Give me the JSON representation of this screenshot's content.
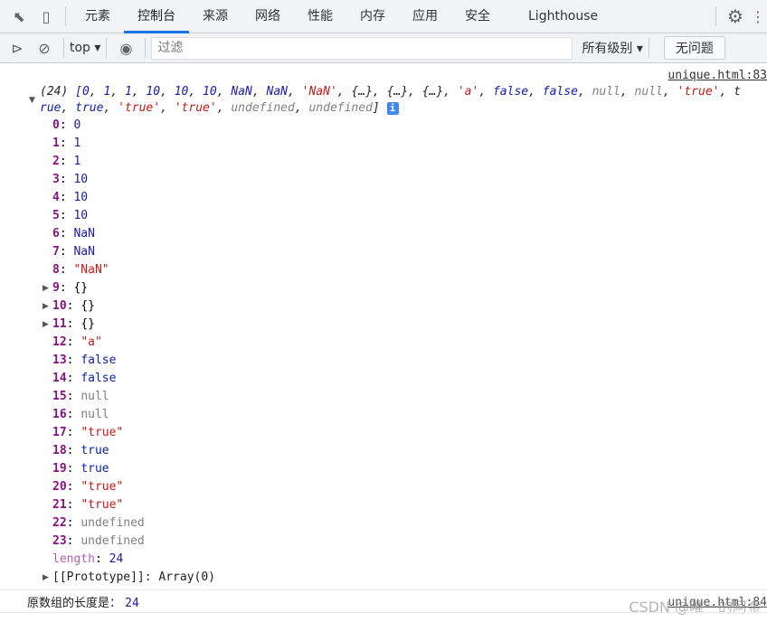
{
  "tabs": [
    "元素",
    "控制台",
    "来源",
    "网络",
    "性能",
    "内存",
    "应用",
    "安全",
    "Lighthouse"
  ],
  "toolbar": {
    "context": "top",
    "filter_placeholder": "过滤",
    "levels": "所有级别",
    "issues": "无问题"
  },
  "source": "unique.html:83",
  "summary": {
    "count": "(24)",
    "line1": [
      [
        "[0",
        "n"
      ],
      [
        ", ",
        ""
      ],
      [
        "1",
        "n"
      ],
      [
        ", ",
        ""
      ],
      [
        "1",
        "n"
      ],
      [
        ", ",
        ""
      ],
      [
        "10",
        "n"
      ],
      [
        ", ",
        ""
      ],
      [
        "10",
        "n"
      ],
      [
        ", ",
        ""
      ],
      [
        "10",
        "n"
      ],
      [
        ", ",
        ""
      ],
      [
        "NaN",
        "n"
      ],
      [
        ", ",
        ""
      ],
      [
        "NaN",
        "n"
      ],
      [
        ", ",
        ""
      ],
      [
        "'NaN'",
        "s"
      ],
      [
        ", {…}, {…}, {…}, ",
        ""
      ],
      [
        "'a'",
        "s"
      ],
      [
        ", ",
        ""
      ],
      [
        "false",
        "b"
      ],
      [
        ", ",
        ""
      ],
      [
        "false",
        "b"
      ],
      [
        ", ",
        ""
      ],
      [
        "null",
        "g"
      ],
      [
        ", ",
        ""
      ],
      [
        "null",
        "g"
      ],
      [
        ", ",
        ""
      ],
      [
        "'true'",
        "s"
      ],
      [
        ", t",
        ""
      ]
    ],
    "line2": [
      [
        "rue",
        "b"
      ],
      [
        ", ",
        ""
      ],
      [
        "true",
        "b"
      ],
      [
        ", ",
        ""
      ],
      [
        "'true'",
        "s"
      ],
      [
        ", ",
        ""
      ],
      [
        "'true'",
        "s"
      ],
      [
        ", ",
        ""
      ],
      [
        "undefined",
        "g"
      ],
      [
        ", ",
        ""
      ],
      [
        "undefined",
        "g"
      ],
      [
        "]",
        ""
      ]
    ]
  },
  "items": [
    [
      "0",
      "0",
      "n"
    ],
    [
      "1",
      "1",
      "n"
    ],
    [
      "2",
      "1",
      "n"
    ],
    [
      "3",
      "10",
      "n"
    ],
    [
      "4",
      "10",
      "n"
    ],
    [
      "5",
      "10",
      "n"
    ],
    [
      "6",
      "NaN",
      "n"
    ],
    [
      "7",
      "NaN",
      "n"
    ],
    [
      "8",
      "\"NaN\"",
      "s"
    ],
    [
      "9",
      "{}",
      "",
      true
    ],
    [
      "10",
      "{}",
      "",
      true
    ],
    [
      "11",
      "{}",
      "",
      true
    ],
    [
      "12",
      "\"a\"",
      "s"
    ],
    [
      "13",
      "false",
      "b"
    ],
    [
      "14",
      "false",
      "b"
    ],
    [
      "15",
      "null",
      "g"
    ],
    [
      "16",
      "null",
      "g"
    ],
    [
      "17",
      "\"true\"",
      "s"
    ],
    [
      "18",
      "true",
      "b"
    ],
    [
      "19",
      "true",
      "b"
    ],
    [
      "20",
      "\"true\"",
      "s"
    ],
    [
      "21",
      "\"true\"",
      "s"
    ],
    [
      "22",
      "undefined",
      "g"
    ],
    [
      "23",
      "undefined",
      "g"
    ]
  ],
  "length_label": "length",
  "length_value": "24",
  "prototype": "[[Prototype]]: Array(0)",
  "log": {
    "label": "原数组的长度是：",
    "value": "24",
    "source": "unique.html:84"
  },
  "watermark": "CSDN @唯一的阿金",
  "colors": {
    "accent": "#1a73e8",
    "key": "#881280",
    "number": "#1a1aa6",
    "string": "#c41a16"
  }
}
